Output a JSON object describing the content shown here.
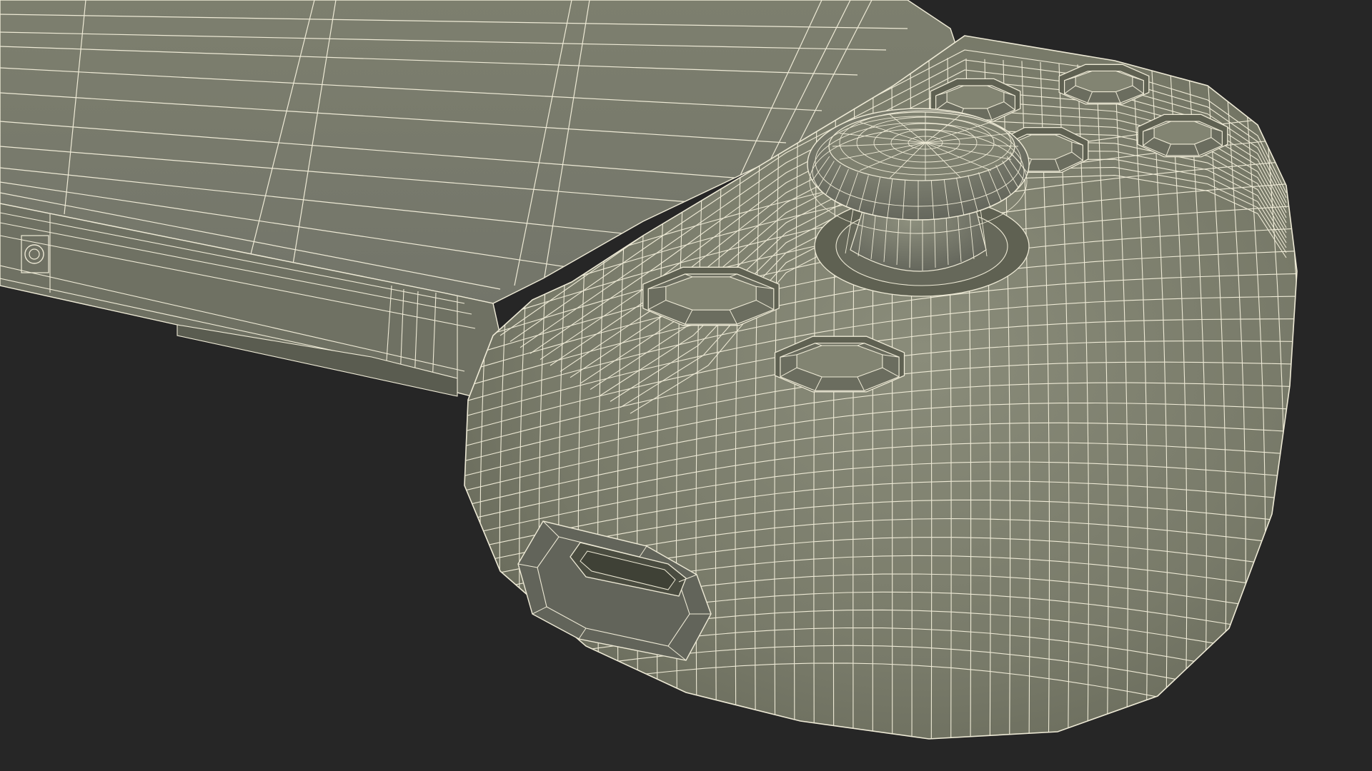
{
  "scene": {
    "subject": "handheld-controller-wireframe",
    "colors": {
      "background": "#262626",
      "surface": "#787a69",
      "surface_shadow": "#5f6152",
      "surface_highlight": "#8a8c7a",
      "wire": "#eeead6",
      "port_inner": "#4a4c40"
    },
    "parts": [
      {
        "name": "screen-panel"
      },
      {
        "name": "side-rail"
      },
      {
        "name": "grip-body"
      },
      {
        "name": "analog-stick"
      },
      {
        "name": "face-button-top"
      },
      {
        "name": "face-button-right"
      },
      {
        "name": "face-button-left"
      },
      {
        "name": "face-button-bottom"
      },
      {
        "name": "dpad-button-upper"
      },
      {
        "name": "dpad-button-lower"
      },
      {
        "name": "usb-port"
      },
      {
        "name": "side-screw"
      }
    ]
  }
}
